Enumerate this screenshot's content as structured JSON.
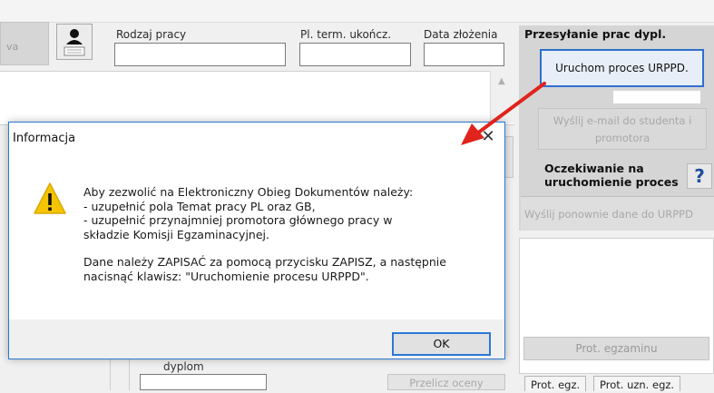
{
  "left_tab": {
    "label": "va"
  },
  "fields": {
    "rodzaj_pracy": {
      "label": "Rodzaj pracy",
      "value": ""
    },
    "pl_term": {
      "label": "Pl. term. ukończ.",
      "value": ""
    },
    "data_zlozenia": {
      "label": "Data złożenia",
      "value": ""
    }
  },
  "panel": {
    "title": "Przesyłanie prac dypl.",
    "urppd_button": "Uruchom proces URPPD.",
    "email_button_line1": "Wyślij e-mail do studenta i",
    "email_button_line2": "promotora",
    "wait_line1": "Oczekiwanie na",
    "wait_line2": "uruchomienie proces",
    "help_button": "?",
    "resend_button": "Wyślij ponownie dane do URPPD",
    "prot_button": "Prot. egzaminu"
  },
  "bottom": {
    "dyplom_label": "dyplom",
    "przelicz_button": "Przelicz oceny",
    "tabs": [
      "Prot. egz.",
      "Prot. uzn. egz."
    ]
  },
  "dialog": {
    "title": "Informacja",
    "close_glyph": "✕",
    "line1": "Aby zezwolić na Elektroniczny Obieg Dokumentów należy:",
    "line2": "- uzupełnić pola Temat pracy PL oraz GB,",
    "line3": "- uzupełnić przynajmniej promotora głównego pracy w",
    "line4": "składzie Komisji Egzaminacyjnej.",
    "line5": "Dane należy ZAPISAĆ za pomocą przycisku ZAPISZ, a następnie",
    "line6": "nacisnąć klawisz: \"Uruchomienie procesu URPPD\".",
    "ok_button": "OK"
  },
  "colors": {
    "accent": "#2b78d6",
    "arrow": "#e0231c",
    "warning": "#f5c400"
  },
  "icons": {
    "person": "person-icon",
    "warning": "warning-icon",
    "close": "close-icon",
    "help": "help-icon"
  }
}
